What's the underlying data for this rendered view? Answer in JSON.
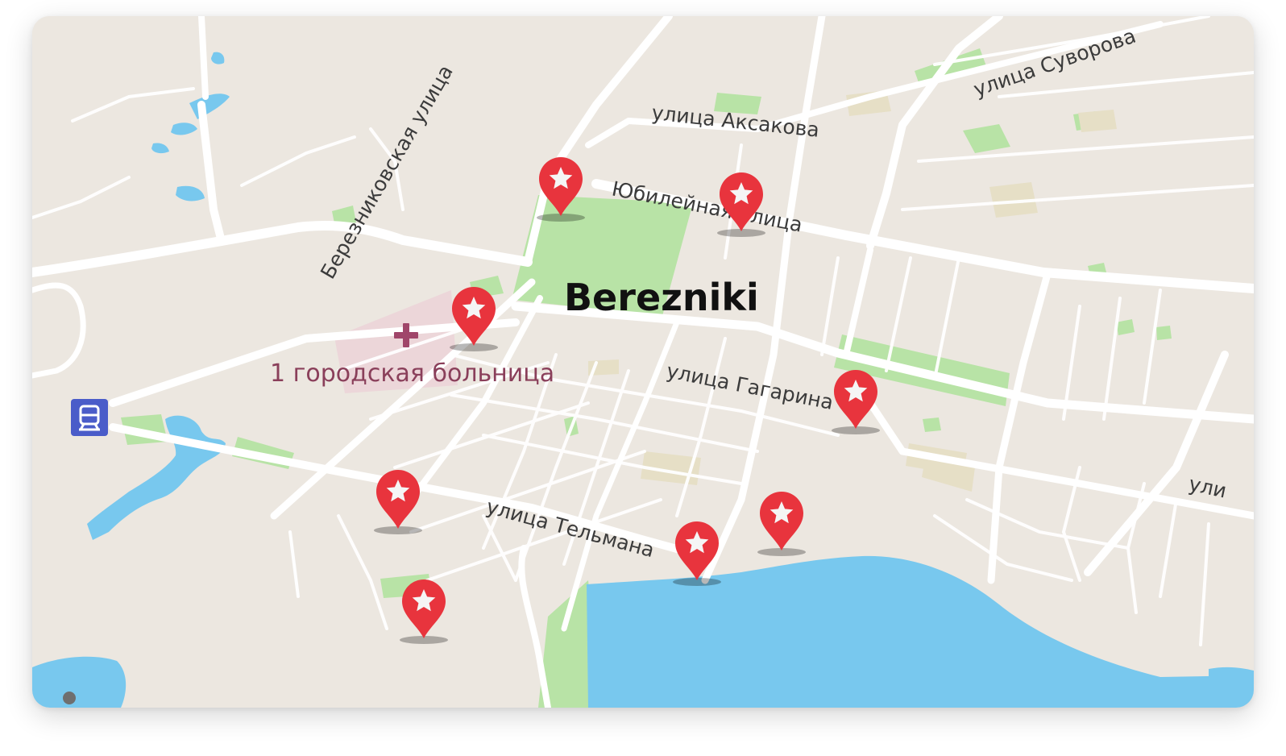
{
  "map": {
    "city": "Berezniki",
    "poi": {
      "label": "1 городская больница",
      "icon": "hospital-cross-icon"
    },
    "streets": {
      "berezniki": "Березниковская улица",
      "aksakova": "улица Аксакова",
      "suvorova": "улица Суворова",
      "yubileynaya": "Юбилейная улица",
      "gagarina": "улица Гагарина",
      "telmana": "улица Тельмана",
      "edge": "ули"
    },
    "markers": {
      "count": 8,
      "icon": "star-pin-icon",
      "color": "#e8343d"
    },
    "station": {
      "icon": "train-station-icon",
      "color": "#4a5cc9"
    },
    "colors": {
      "land": "#ece7e0",
      "water": "#78c8ee",
      "park": "#b8e3a6",
      "road": "#ffffff",
      "hospital": "#ecd6d9"
    }
  }
}
